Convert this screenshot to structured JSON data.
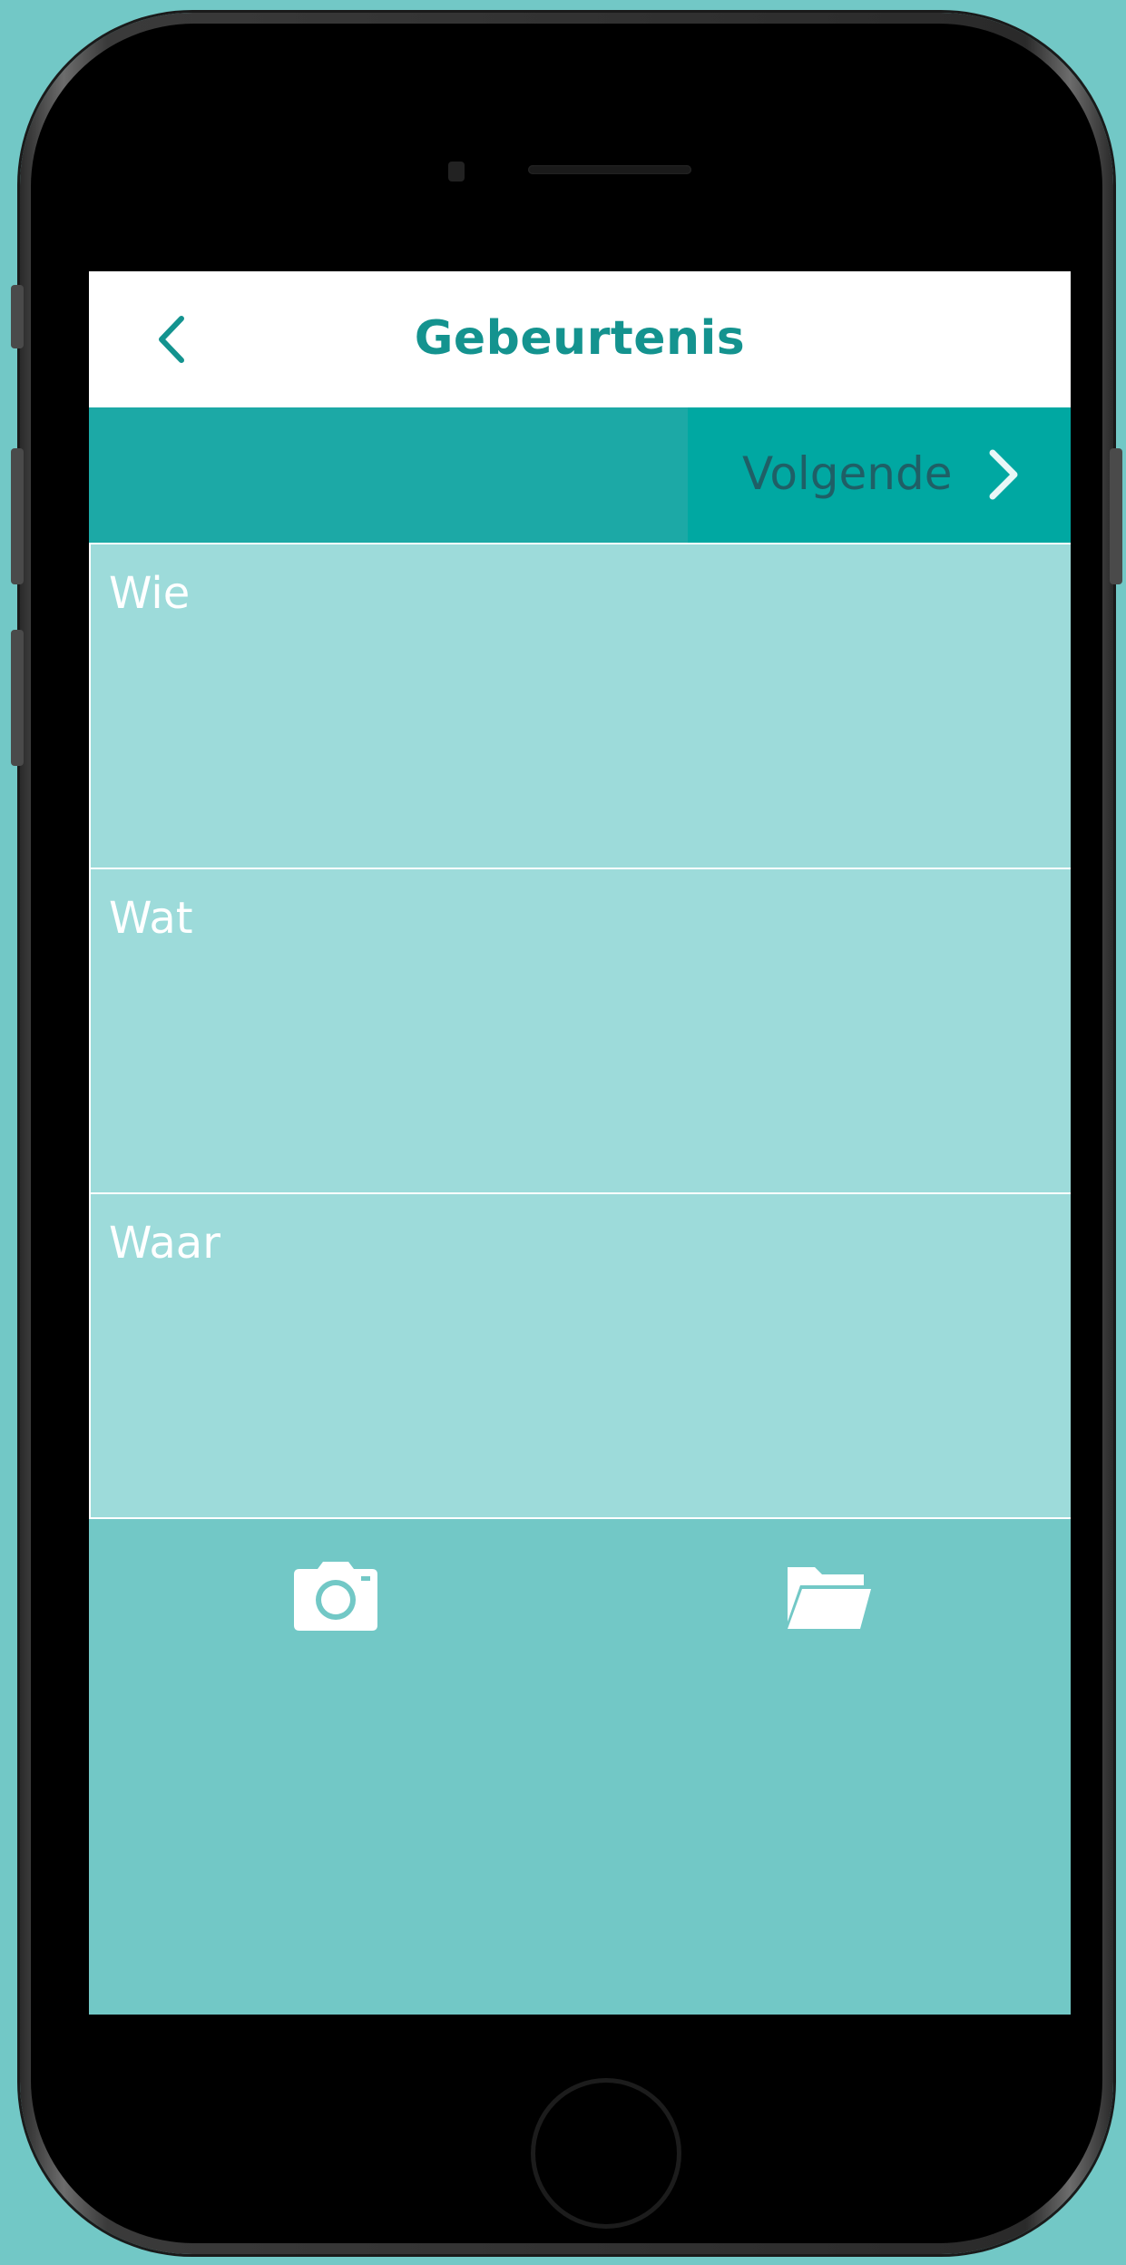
{
  "navbar": {
    "title": "Gebeurtenis",
    "back_icon": "chevron-left-icon"
  },
  "toolbar": {
    "next_label": "Volgende",
    "next_icon": "chevron-right-icon"
  },
  "fields": [
    {
      "label": "Wie"
    },
    {
      "label": "Wat"
    },
    {
      "label": "Waar"
    }
  ],
  "actions": {
    "camera_icon": "camera-icon",
    "folder_icon": "folder-icon"
  },
  "colors": {
    "accent": "#14938f",
    "toolbar": "#1ca9a6",
    "next_button": "#00a8a2",
    "field_bg": "#9ddbda",
    "background": "#72c8c6"
  }
}
